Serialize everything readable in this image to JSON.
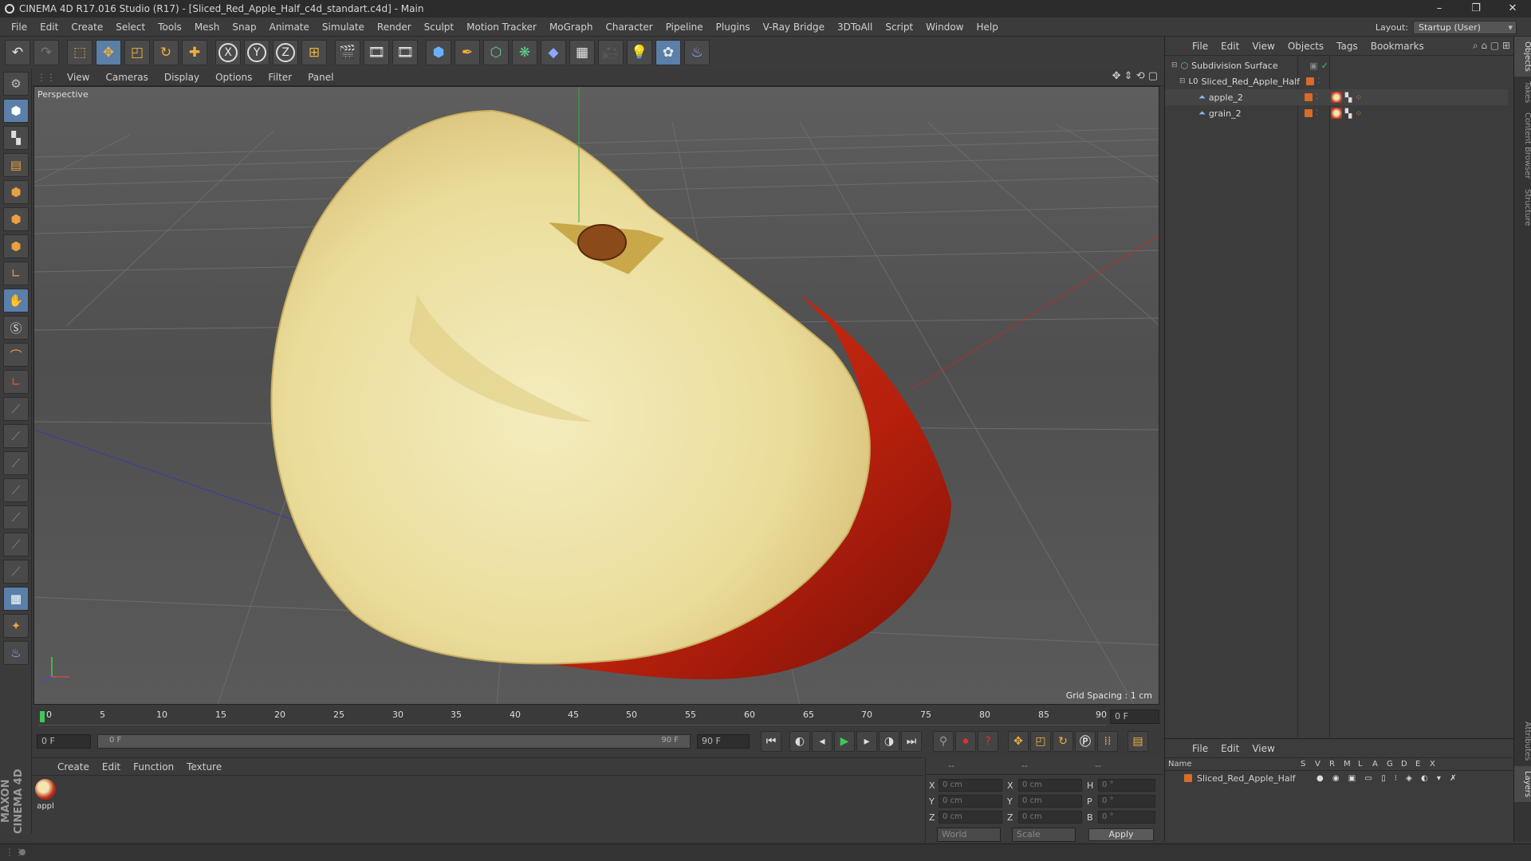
{
  "window": {
    "title": "CINEMA 4D R17.016 Studio (R17) - [Sliced_Red_Apple_Half_c4d_standart.c4d] - Main",
    "minimize": "–",
    "maximize": "❐",
    "close": "✕"
  },
  "menu": [
    "File",
    "Edit",
    "Create",
    "Select",
    "Tools",
    "Mesh",
    "Snap",
    "Animate",
    "Simulate",
    "Render",
    "Sculpt",
    "Motion Tracker",
    "MoGraph",
    "Character",
    "Pipeline",
    "Plugins",
    "V-Ray Bridge",
    "3DToAll",
    "Script",
    "Window",
    "Help"
  ],
  "layout": {
    "label": "Layout:",
    "value": "Startup (User)"
  },
  "viewport": {
    "menu": [
      "View",
      "Cameras",
      "Display",
      "Options",
      "Filter",
      "Panel"
    ],
    "label": "Perspective",
    "grid_spacing": "Grid Spacing : 1 cm"
  },
  "timeline": {
    "ticks": [
      "0",
      "5",
      "10",
      "15",
      "20",
      "25",
      "30",
      "35",
      "40",
      "45",
      "50",
      "55",
      "60",
      "65",
      "70",
      "75",
      "80",
      "85",
      "90"
    ],
    "current_frame": "0 F",
    "start_field": "0 F",
    "range_start": "0 F",
    "range_end": "90 F",
    "end_field": "90 F"
  },
  "material_manager": {
    "menu": [
      "Create",
      "Edit",
      "Function",
      "Texture"
    ],
    "material_label": "appl"
  },
  "coordinates": {
    "header": [
      "--",
      "--",
      "--"
    ],
    "rows": [
      {
        "axis": "X",
        "pos": "0 cm",
        "axis2": "X",
        "size": "0 cm",
        "rot_axis": "H",
        "rot": "0 °"
      },
      {
        "axis": "Y",
        "pos": "0 cm",
        "axis2": "Y",
        "size": "0 cm",
        "rot_axis": "P",
        "rot": "0 °"
      },
      {
        "axis": "Z",
        "pos": "0 cm",
        "axis2": "Z",
        "size": "0 cm",
        "rot_axis": "B",
        "rot": "0 °"
      }
    ],
    "mode": "World",
    "mode2": "Scale",
    "apply": "Apply"
  },
  "object_manager": {
    "menu": [
      "File",
      "Edit",
      "View",
      "Objects",
      "Tags",
      "Bookmarks"
    ],
    "objects": [
      {
        "name": "Subdivision Surface"
      },
      {
        "name": "Sliced_Red_Apple_Half"
      },
      {
        "name": "apple_2"
      },
      {
        "name": "grain_2"
      }
    ]
  },
  "layer_manager": {
    "menu": [
      "File",
      "Edit",
      "View"
    ],
    "columns": [
      "Name",
      "S",
      "V",
      "R",
      "M",
      "L",
      "A",
      "G",
      "D",
      "E",
      "X"
    ],
    "layers": [
      {
        "name": "Sliced_Red_Apple_Half"
      }
    ]
  },
  "side_tabs": [
    "Objects",
    "Takes",
    "Content Browser",
    "Structure",
    "Attributes",
    "Layers"
  ],
  "branding": "MAXON CINEMA 4D",
  "colors": {
    "accent": "#5a7fa8",
    "layer_orange": "#d86a2a",
    "apple_red": "#b8200e",
    "apple_flesh": "#efe4a6"
  }
}
